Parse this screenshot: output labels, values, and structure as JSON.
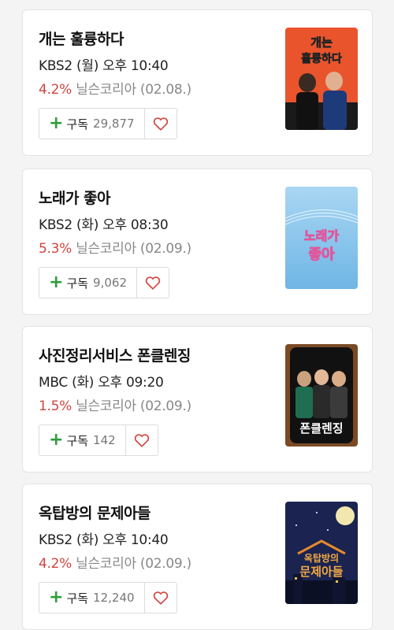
{
  "shows": [
    {
      "title": "개는 훌륭하다",
      "schedule": "KBS2 (월) 오후 10:40",
      "rating": "4.2%",
      "source": "닐슨코리아 (02.08.)",
      "subscribe_label": "구독",
      "subscribers": "29,877",
      "poster_text": [
        "개는",
        "훌륭하다"
      ]
    },
    {
      "title": "노래가 좋아",
      "schedule": "KBS2 (화) 오후 08:30",
      "rating": "5.3%",
      "source": "닐슨코리아 (02.09.)",
      "subscribe_label": "구독",
      "subscribers": "9,062",
      "poster_text": [
        "노래가",
        "좋아"
      ]
    },
    {
      "title": "사진정리서비스 폰클렌징",
      "schedule": "MBC (화) 오후 09:20",
      "rating": "1.5%",
      "source": "닐슨코리아 (02.09.)",
      "subscribe_label": "구독",
      "subscribers": "142",
      "poster_text": [
        "폰클렌징"
      ]
    },
    {
      "title": "옥탑방의 문제아들",
      "schedule": "KBS2 (화) 오후 10:40",
      "rating": "4.2%",
      "source": "닐슨코리아 (02.09.)",
      "subscribe_label": "구독",
      "subscribers": "12,240",
      "poster_text": [
        "옥탑방의",
        "문제아들"
      ]
    }
  ],
  "icons": {
    "subscribe": "plus-icon",
    "favorite": "heart-icon"
  },
  "colors": {
    "rating": "#d0453f",
    "plus": "#2e9e3a",
    "heart": "#d0453f"
  }
}
